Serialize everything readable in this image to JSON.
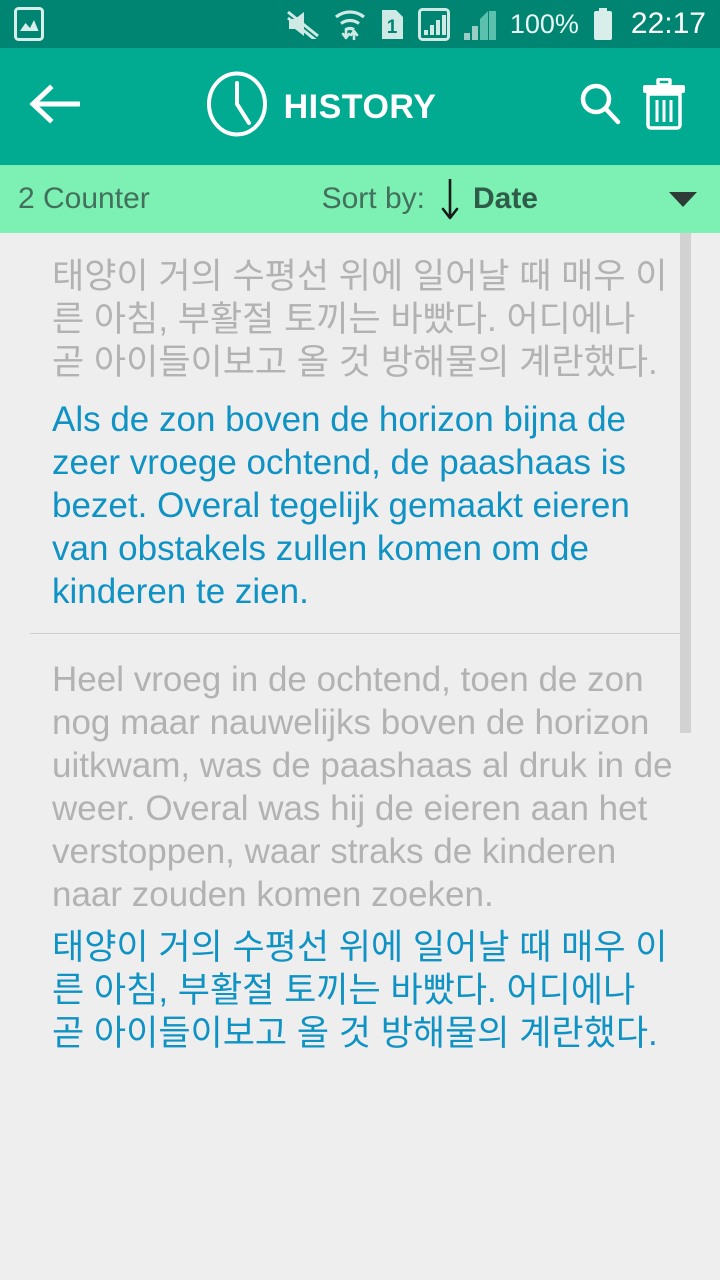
{
  "status_bar": {
    "left_icon": "image-gallery-icon",
    "icons": [
      "mute-icon",
      "wifi-transfer-icon",
      "sim-1-icon",
      "signal-bars-icon",
      "signal-bars-secondary-icon"
    ],
    "battery_percent": "100%",
    "battery_icon": "battery-full-icon",
    "clock": "22:17",
    "background": "#008573"
  },
  "app_bar": {
    "back_icon": "arrow-left-icon",
    "clock_icon": "clock-icon",
    "title": "HISTORY",
    "search_icon": "search-icon",
    "delete_icon": "trash-icon",
    "background": "#00ab91"
  },
  "sort_bar": {
    "counter": "2 Counter",
    "sort_by_label": "Sort by:",
    "direction_icon": "arrow-down-icon",
    "sort_value": "Date",
    "caret_icon": "chevron-down-icon",
    "background": "#7df0b3"
  },
  "colors": {
    "source_text": "#b2b2b2",
    "translation_text": "#0f92c4",
    "content_background": "#eeeeee",
    "divider": "#cfcfcf",
    "scrollbar": "#d2d2d2"
  },
  "entries": [
    {
      "source": "태양이 거의 수평선 위에 일어날 때 매우 이른 아침, 부활절 토끼는 바빴다. 어디에나 곧 아이들이보고 올 것 방해물의 계란했다.",
      "translation": "Als de zon boven de horizon bijna de zeer vroege ochtend, de paashaas is bezet. Overal tegelijk gemaakt eieren van obstakels zullen komen om de kinderen te zien."
    },
    {
      "source": "Heel vroeg in de ochtend, toen de zon nog maar nauwelijks boven de horizon uitkwam, was de paashaas al druk in de weer. Overal was hij de eieren aan het verstoppen, waar straks de kinderen naar zouden komen zoeken.",
      "translation": "태양이 거의 수평선 위에 일어날 때 매우 이른 아침, 부활절 토끼는 바빴다. 어디에나 곧 아이들이보고 올 것 방해물의 계란했다."
    }
  ]
}
